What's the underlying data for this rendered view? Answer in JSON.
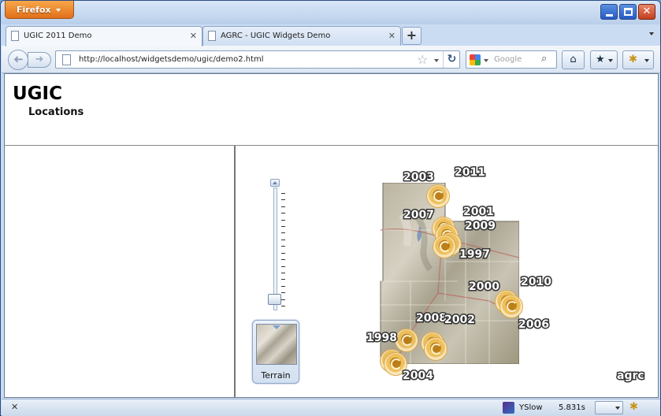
{
  "browser": {
    "app_button": "Firefox",
    "tabs": [
      {
        "title": "UGIC 2011 Demo",
        "active": true
      },
      {
        "title": "AGRC - UGIC Widgets Demo",
        "active": false
      }
    ],
    "url": "http://localhost/widgetsdemo/ugic/demo2.html",
    "search_placeholder": "Google",
    "icons": {
      "back": "back-arrow-icon",
      "forward": "forward-arrow-icon",
      "reload": "reload-icon",
      "bookmark_star": "star-icon",
      "home": "home-icon",
      "bookmarks": "bookmarks-icon",
      "search": "magnifier-icon"
    }
  },
  "page": {
    "title": "UGIC",
    "subtitle": "Locations"
  },
  "map": {
    "basemap_label": "Terrain",
    "zoom_level_fraction": 0.05,
    "logo_text": "agrc",
    "years": [
      "2003",
      "2011",
      "2007",
      "2001",
      "2009",
      "1997",
      "2000",
      "2010",
      "2006",
      "2008",
      "2002",
      "1998",
      "2004"
    ]
  },
  "statusbar": {
    "yslow_label": "YSlow",
    "load_time": "5.831s"
  },
  "colors": {
    "firefox_button": "#e0701a",
    "marker": "#f0c05a",
    "window_frame": "#c9dcf2"
  }
}
